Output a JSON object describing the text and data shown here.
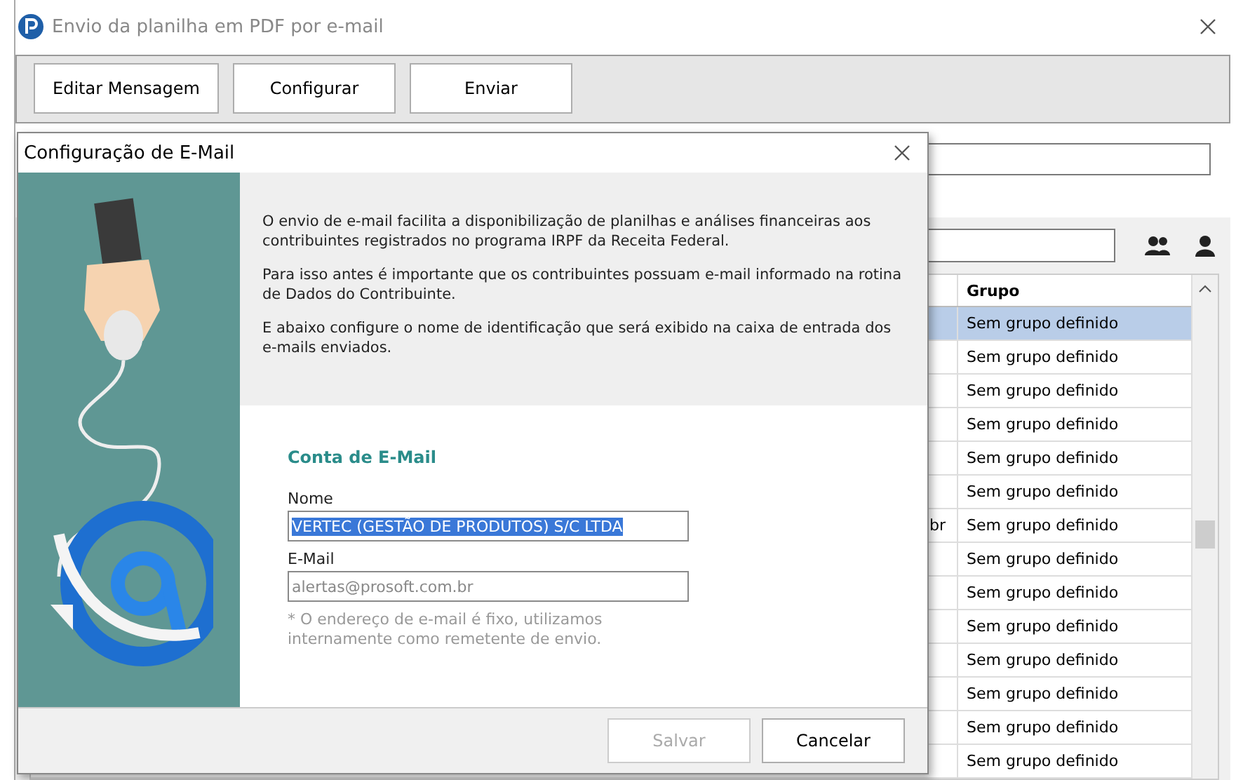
{
  "window": {
    "title": "Envio da planilha em PDF por e-mail"
  },
  "toolbar": [
    {
      "label": "Editar Mensagem"
    },
    {
      "label": "Configurar"
    },
    {
      "label": "Enviar"
    }
  ],
  "table": {
    "columns": [
      {
        "label": "Grupo"
      }
    ],
    "rows": [
      {
        "grupo": "Sem grupo definido",
        "selected": true
      },
      {
        "grupo": "Sem grupo definido",
        "selected": false
      },
      {
        "grupo": "Sem grupo definido",
        "selected": false
      },
      {
        "grupo": "Sem grupo definido",
        "selected": false
      },
      {
        "grupo": "Sem grupo definido",
        "selected": false
      },
      {
        "grupo": "Sem grupo definido",
        "selected": false
      },
      {
        "column_1": "br",
        "grupo": "Sem grupo definido",
        "selected": false
      },
      {
        "grupo": "Sem grupo definido",
        "selected": false
      },
      {
        "grupo": "Sem grupo definido",
        "selected": false
      },
      {
        "grupo": "Sem grupo definido",
        "selected": false
      },
      {
        "grupo": "Sem grupo definido",
        "selected": false
      },
      {
        "grupo": "Sem grupo definido",
        "selected": false
      },
      {
        "grupo": "Sem grupo definido",
        "selected": false
      },
      {
        "grupo": "Sem grupo definido",
        "selected": false
      }
    ]
  },
  "dialog": {
    "title": "Configuração de E-Mail",
    "paragraphs": [
      "O envio de e-mail facilita a disponibilização de planilhas e análises financeiras aos contribuintes registrados no programa IRPF da Receita Federal.",
      "Para isso antes é importante que os contribuintes possuam e-mail informado na rotina de Dados do Contribuinte.",
      "E abaixo configure o nome de identificação que será exibido na caixa de entrada dos e-mails enviados."
    ],
    "section_title": "Conta de E-Mail",
    "fields": [
      {
        "label": "Nome",
        "value": "VERTEC (GESTÃO DE PRODUTOS) S/C LTDA",
        "text_selected": true,
        "disabled": false
      },
      {
        "label": "E-Mail",
        "value": "alertas@prosoft.com.br",
        "text_selected": false,
        "disabled": true
      }
    ],
    "note": "* O endereço de e-mail é fixo, utilizamos internamente como remetente de envio.",
    "buttons": [
      {
        "label": "Salvar",
        "disabled": true
      },
      {
        "label": "Cancelar",
        "disabled": false
      }
    ]
  }
}
